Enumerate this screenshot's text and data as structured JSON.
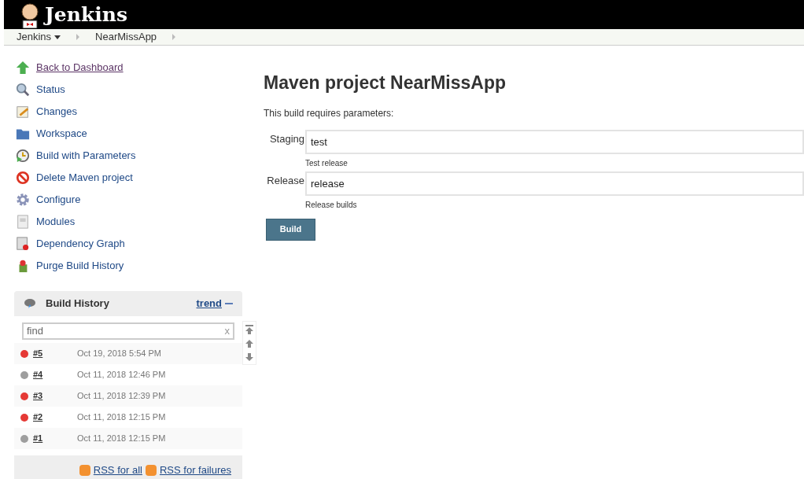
{
  "header": {
    "title": "Jenkins"
  },
  "breadcrumbs": [
    {
      "label": "Jenkins",
      "dropdown": true
    },
    {
      "label": "NearMissApp",
      "dropdown": false
    }
  ],
  "sidebar": {
    "items": [
      {
        "label": "Back to Dashboard",
        "kind": "up",
        "visited": true
      },
      {
        "label": "Status",
        "kind": "search",
        "visited": false
      },
      {
        "label": "Changes",
        "kind": "notepad",
        "visited": false
      },
      {
        "label": "Workspace",
        "kind": "folder",
        "visited": false
      },
      {
        "label": "Build with Parameters",
        "kind": "clock",
        "visited": false
      },
      {
        "label": "Delete Maven project",
        "kind": "forbidden",
        "visited": false
      },
      {
        "label": "Configure",
        "kind": "gear",
        "visited": false
      },
      {
        "label": "Modules",
        "kind": "page",
        "visited": false
      },
      {
        "label": "Dependency Graph",
        "kind": "graph",
        "visited": false
      },
      {
        "label": "Purge Build History",
        "kind": "bin",
        "visited": false
      }
    ]
  },
  "build_history": {
    "title": "Build History",
    "trend": "trend",
    "search": {
      "placeholder": "find",
      "clear": "x"
    },
    "builds": [
      {
        "number": "#5",
        "date": "Oct 19, 2018 5:54 PM",
        "color": "#e53935"
      },
      {
        "number": "#4",
        "date": "Oct 11, 2018 12:46 PM",
        "color": "#9e9e9e"
      },
      {
        "number": "#3",
        "date": "Oct 11, 2018 12:39 PM",
        "color": "#e53935"
      },
      {
        "number": "#2",
        "date": "Oct 11, 2018 12:15 PM",
        "color": "#e53935"
      },
      {
        "number": "#1",
        "date": "Oct 11, 2018 12:15 PM",
        "color": "#9e9e9e"
      }
    ],
    "rss": [
      "RSS for all",
      "RSS for failures"
    ]
  },
  "main": {
    "title": "Maven project NearMissApp",
    "intro": "This build requires parameters:",
    "parameters": [
      {
        "label": "Staging",
        "value": "test",
        "description": "Test release"
      },
      {
        "label": "Release",
        "value": "release",
        "description": "Release builds"
      }
    ],
    "button": "Build"
  }
}
